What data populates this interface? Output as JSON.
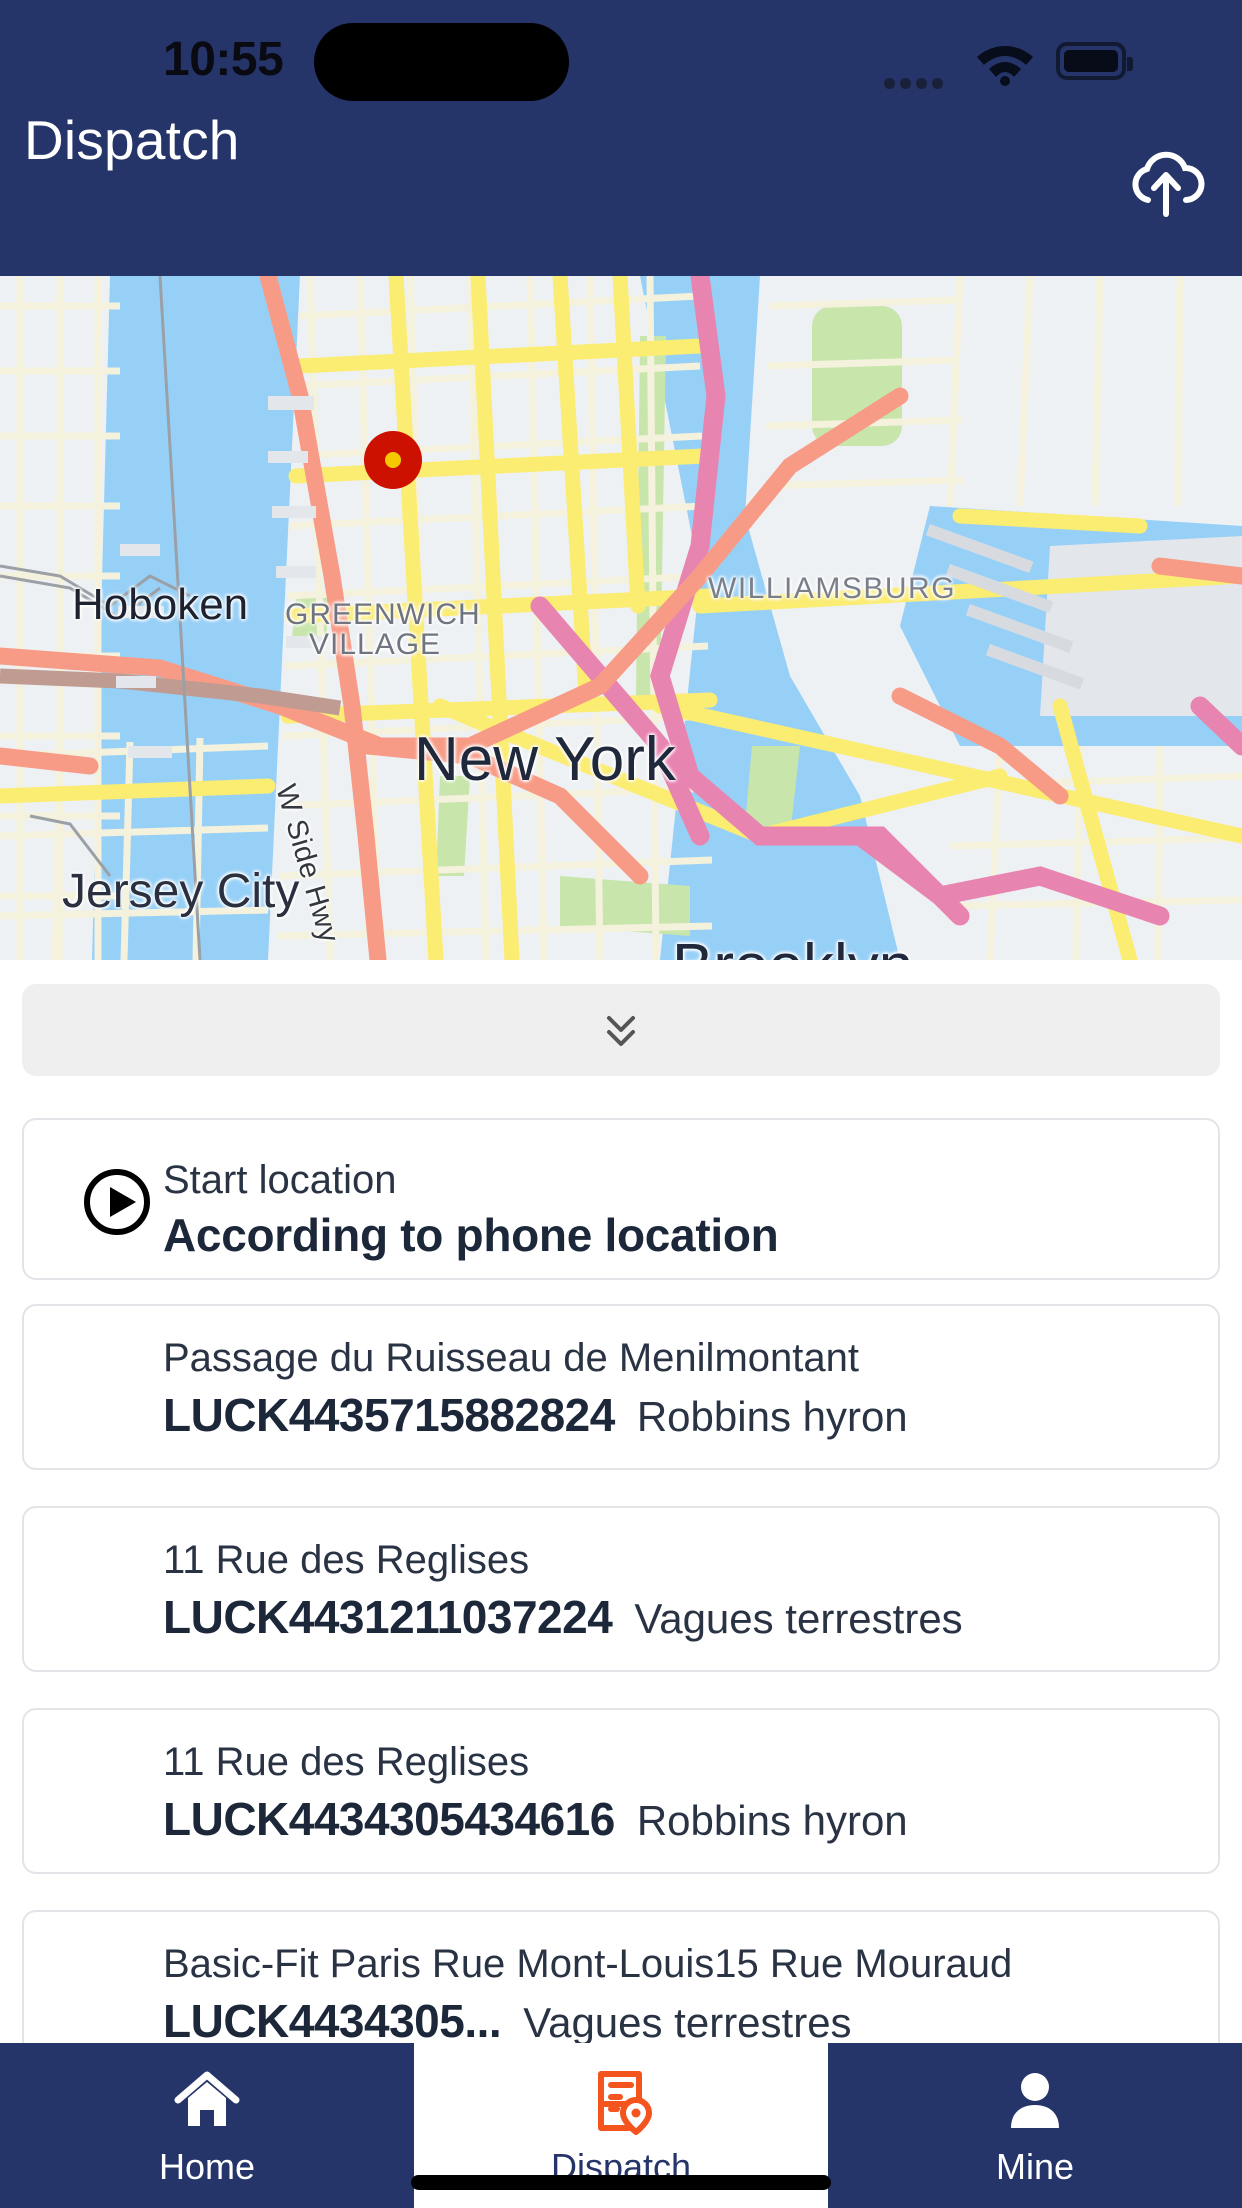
{
  "status_bar": {
    "time": "10:55",
    "signal_icon": "signal-dots-icon",
    "wifi_icon": "wifi-icon",
    "battery_icon": "battery-icon"
  },
  "header": {
    "title": "Dispatch",
    "upload_icon": "cloud-upload-icon",
    "background_color": "#253569"
  },
  "map": {
    "labels": {
      "hoboken": "Hoboken",
      "new_york": "New York",
      "jersey_city": "Jersey City",
      "greenwich": "GREENWICH",
      "village": "VILLAGE",
      "williamsburg": "WILLIAMSBURG",
      "brooklyn": "Brooklyn",
      "w_side_hwy": "W Side Hwy"
    },
    "current_location_marker": "current-location-marker",
    "marker_color": "#cc1100"
  },
  "sheet": {
    "collapse_icon": "double-chevron-down-icon",
    "start_card": {
      "icon": "play-circle-icon",
      "label": "Start location",
      "value": "According to phone location"
    },
    "orders": [
      {
        "address": "Passage du Ruisseau de Menilmontant",
        "order_no": "LUCK4435715882824",
        "customer": "Robbins hyron"
      },
      {
        "address": "11 Rue des Reglises",
        "order_no": "LUCK4431211037224",
        "customer": "Vagues terrestres"
      },
      {
        "address": "11 Rue des Reglises",
        "order_no": "LUCK4434305434616",
        "customer": "Robbins hyron"
      },
      {
        "address": "Basic-Fit Paris Rue Mont-Louis15 Rue Mouraud",
        "order_no": "LUCK4434305...",
        "customer": "Vagues terrestres"
      }
    ]
  },
  "tab_bar": {
    "background_color": "#253569",
    "active_color": "#f4551e",
    "tabs": [
      {
        "label": "Home",
        "icon": "home-icon",
        "active": false
      },
      {
        "label": "Dispatch",
        "icon": "dispatch-icon",
        "active": true
      },
      {
        "label": "Mine",
        "icon": "person-icon",
        "active": false
      }
    ]
  }
}
